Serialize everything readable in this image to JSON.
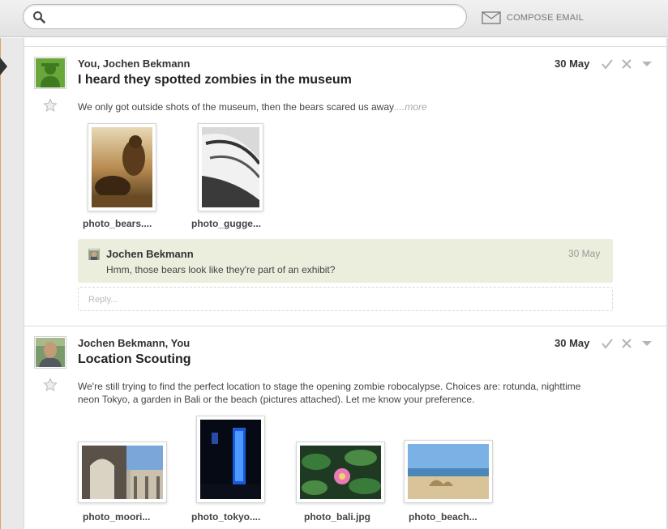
{
  "toolbar": {
    "search_placeholder": "",
    "compose_label": "COMPOSE EMAIL"
  },
  "threads": [
    {
      "participants": "You, Jochen Bekmann",
      "subject": "I heard they spotted zombies in the museum",
      "date": "30 May",
      "body": "We only got outside shots of the museum, then the bears scared us away",
      "more_label": "....more",
      "attachments": [
        {
          "name": "photo_bears...."
        },
        {
          "name": "photo_gugge..."
        }
      ],
      "reply": {
        "author": "Jochen Bekmann",
        "date": "30 May",
        "text": "Hmm, those bears look like they're part of an exhibit?"
      },
      "reply_placeholder": "Reply..."
    },
    {
      "participants": "Jochen Bekmann, You",
      "subject": "Location Scouting",
      "date": "30 May",
      "body": "We're still trying to find the perfect location to stage the opening zombie robocalypse. Choices are: rotunda, nighttime neon Tokyo, a garden in Bali or the beach (pictures attached). Let me know your preference.",
      "attachments": [
        {
          "name": "photo_moori..."
        },
        {
          "name": "photo_tokyo...."
        },
        {
          "name": "photo_bali.jpg"
        },
        {
          "name": "photo_beach..."
        }
      ]
    }
  ]
}
